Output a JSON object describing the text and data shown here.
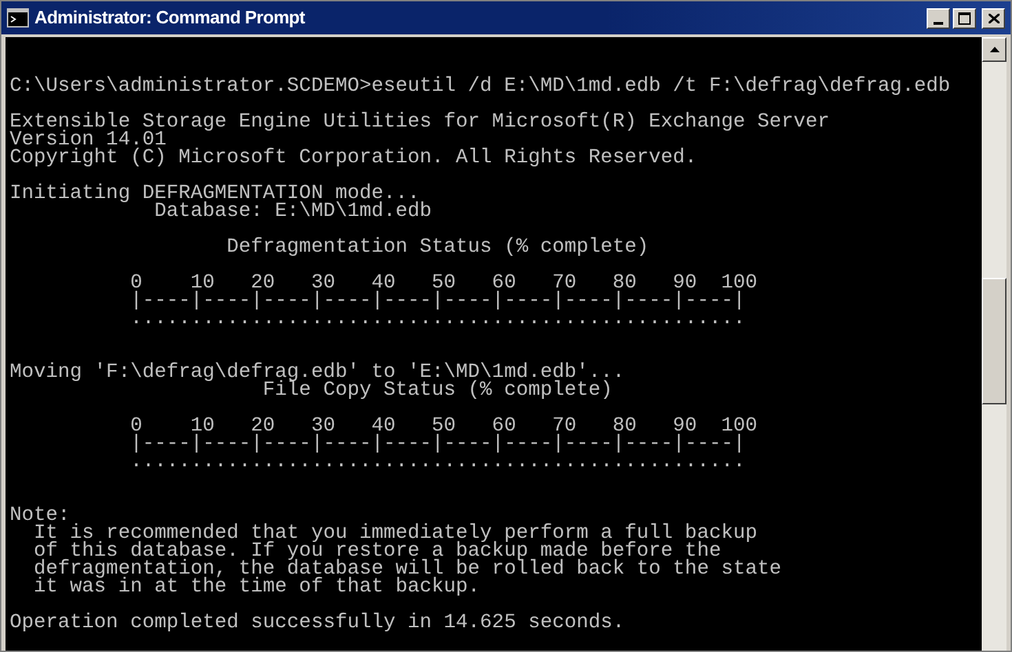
{
  "window": {
    "title": "Administrator: Command Prompt"
  },
  "console": {
    "sections": [
      {
        "paragraphs": [
          {
            "lines": [
              "C:\\Users\\administrator.SCDEMO>eseutil /d E:\\MD\\1md.edb /t F:\\defrag\\defrag.edb"
            ]
          },
          {
            "lines": [
              "Extensible Storage Engine Utilities for Microsoft(R) Exchange Server",
              "Version 14.01",
              "Copyright (C) Microsoft Corporation. All Rights Reserved."
            ]
          },
          {
            "lines": [
              "Initiating DEFRAGMENTATION mode...",
              "            Database: E:\\MD\\1md.edb"
            ]
          },
          {
            "lines": [
              "                  Defragmentation Status (% complete)"
            ]
          },
          {
            "lines": [
              "          0    10   20   30   40   50   60   70   80   90  100",
              "          |----|----|----|----|----|----|----|----|----|----|",
              "          ..................................................."
            ]
          }
        ]
      },
      {
        "paragraphs": [
          {
            "lines": [
              "Moving 'F:\\defrag\\defrag.edb' to 'E:\\MD\\1md.edb'...",
              "                     File Copy Status (% complete)"
            ]
          },
          {
            "lines": [
              "          0    10   20   30   40   50   60   70   80   90  100",
              "          |----|----|----|----|----|----|----|----|----|----|",
              "          ..................................................."
            ]
          }
        ]
      },
      {
        "paragraphs": [
          {
            "lines": [
              "Note:",
              "  It is recommended that you immediately perform a full backup",
              "  of this database. If you restore a backup made before the",
              "  defragmentation, the database will be rolled back to the state",
              "  it was in at the time of that backup."
            ]
          },
          {
            "lines": [
              "Operation completed successfully in 14.625 seconds."
            ]
          }
        ]
      }
    ]
  }
}
